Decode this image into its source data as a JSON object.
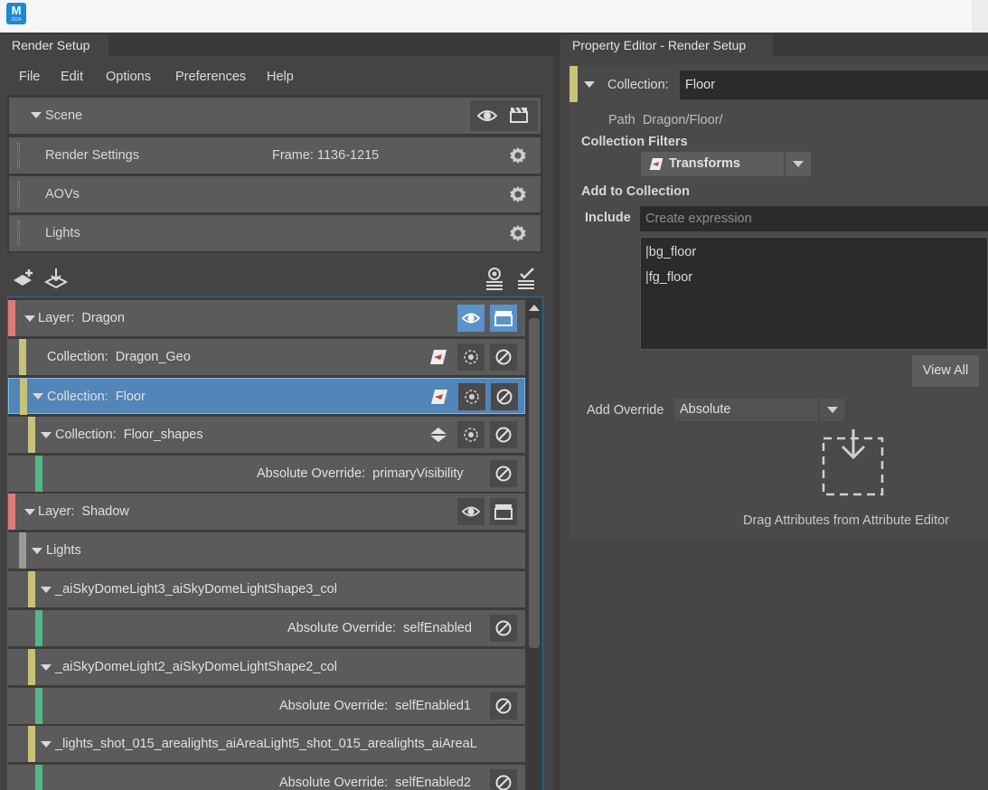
{
  "app": {
    "logo_letter": "M",
    "logo_sub": "2024"
  },
  "tabs": {
    "render_setup": "Render Setup",
    "property_editor": "Property Editor - Render Setup"
  },
  "menu": [
    "File",
    "Edit",
    "Options",
    "Preferences",
    "Help"
  ],
  "scene": {
    "title": "Scene",
    "rows": [
      {
        "label": "Render Settings",
        "info": "Frame: 1136-1215"
      },
      {
        "label": "AOVs",
        "info": ""
      },
      {
        "label": "Lights",
        "info": ""
      }
    ]
  },
  "tree": {
    "layer1": {
      "prefix": "Layer:",
      "name": "Dragon"
    },
    "coll1": {
      "prefix": "Collection:",
      "name": "Dragon_Geo"
    },
    "coll2": {
      "prefix": "Collection:",
      "name": "Floor"
    },
    "coll3": {
      "prefix": "Collection:",
      "name": "Floor_shapes"
    },
    "ov1": {
      "prefix": "Absolute Override:",
      "name": "primaryVisibility"
    },
    "layer2": {
      "prefix": "Layer:",
      "name": "Shadow"
    },
    "lights": "Lights",
    "lc1": "_aiSkyDomeLight3_aiSkyDomeLightShape3_col",
    "ov2": {
      "prefix": "Absolute Override:",
      "name": "selfEnabled"
    },
    "lc2": "_aiSkyDomeLight2_aiSkyDomeLightShape2_col",
    "ov3": {
      "prefix": "Absolute Override:",
      "name": "selfEnabled1"
    },
    "lc3": "_lights_shot_015_arealights_aiAreaLight5_shot_015_arealights_aiAreaL",
    "ov4": {
      "prefix": "Absolute Override:",
      "name": "selfEnabled2"
    }
  },
  "property_editor": {
    "collection_label": "Collection:",
    "collection_name": "Floor",
    "path_label": "Path",
    "path_value": "Dragon/Floor/",
    "filters_heading": "Collection Filters",
    "filter_value": "Transforms",
    "add_heading": "Add to Collection",
    "include_label": "Include",
    "include_placeholder": "Create expression",
    "members": [
      "|bg_floor",
      "|fg_floor"
    ],
    "view_all": "View All",
    "add_override_label": "Add Override",
    "add_override_value": "Absolute",
    "drag_hint": "Drag Attributes from Attribute Editor"
  },
  "colors": {
    "layer": "#e07a7a",
    "collection": "#c8c276",
    "override": "#52b888",
    "lights": "#9a9a9a",
    "selected": "#5285b8"
  }
}
